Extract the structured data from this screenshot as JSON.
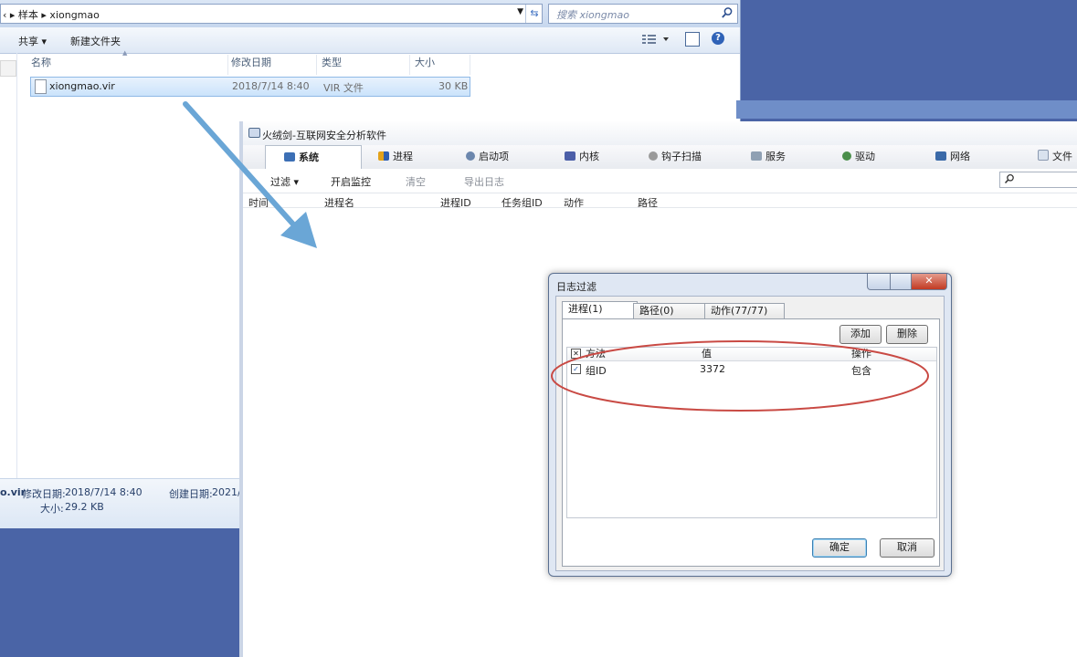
{
  "explorer": {
    "breadcrumb_text": "‹ ▸ 样本 ▸ xiongmao",
    "search_placeholder": "搜索 xiongmao",
    "toolbar": {
      "share": "共享 ▾",
      "new_folder": "新建文件夹"
    },
    "columns": [
      "名称",
      "修改日期",
      "类型",
      "大小"
    ],
    "file": {
      "name": "xiongmao.vir",
      "modified": "2018/7/14 8:40",
      "type": "VIR 文件",
      "size": "30 KB"
    },
    "status": {
      "name_tail": "o.vir",
      "modified_label": "修改日期:",
      "modified_value": "2018/7/14 8:40",
      "created_label": "创建日期:",
      "created_value": "2021/",
      "size_label": "大小:",
      "size_value": "29.2 KB"
    }
  },
  "app": {
    "title": "火绒剑-互联网安全分析软件",
    "tabs": [
      "系统",
      "进程",
      "启动项",
      "内核",
      "钩子扫描",
      "服务",
      "驱动",
      "网络",
      "文件"
    ],
    "active_tab": "系统",
    "subbar": {
      "filter": "过滤 ▾",
      "start_monitor": "开启监控",
      "clear": "清空",
      "export_log": "导出日志"
    },
    "list_headers": [
      "时间",
      "进程名",
      "进程ID",
      "任务组ID",
      "动作",
      "路径"
    ]
  },
  "dialog": {
    "title": "日志过滤",
    "tabs": [
      "进程(1)",
      "路径(0)",
      "动作(77/77)"
    ],
    "add_button": "添加",
    "delete_button": "删除",
    "grid_headers": {
      "method": "方法",
      "value": "值",
      "operation": "操作"
    },
    "row": {
      "checked": true,
      "method": "组ID",
      "value": "3372",
      "operation": "包含"
    },
    "ok_button": "确定",
    "cancel_button": "取消"
  },
  "colors": {
    "desktop": "#4a64a6",
    "arrow": "#6aa6d6",
    "annotation": "#c94a44",
    "selection": "#cbe3fb"
  }
}
